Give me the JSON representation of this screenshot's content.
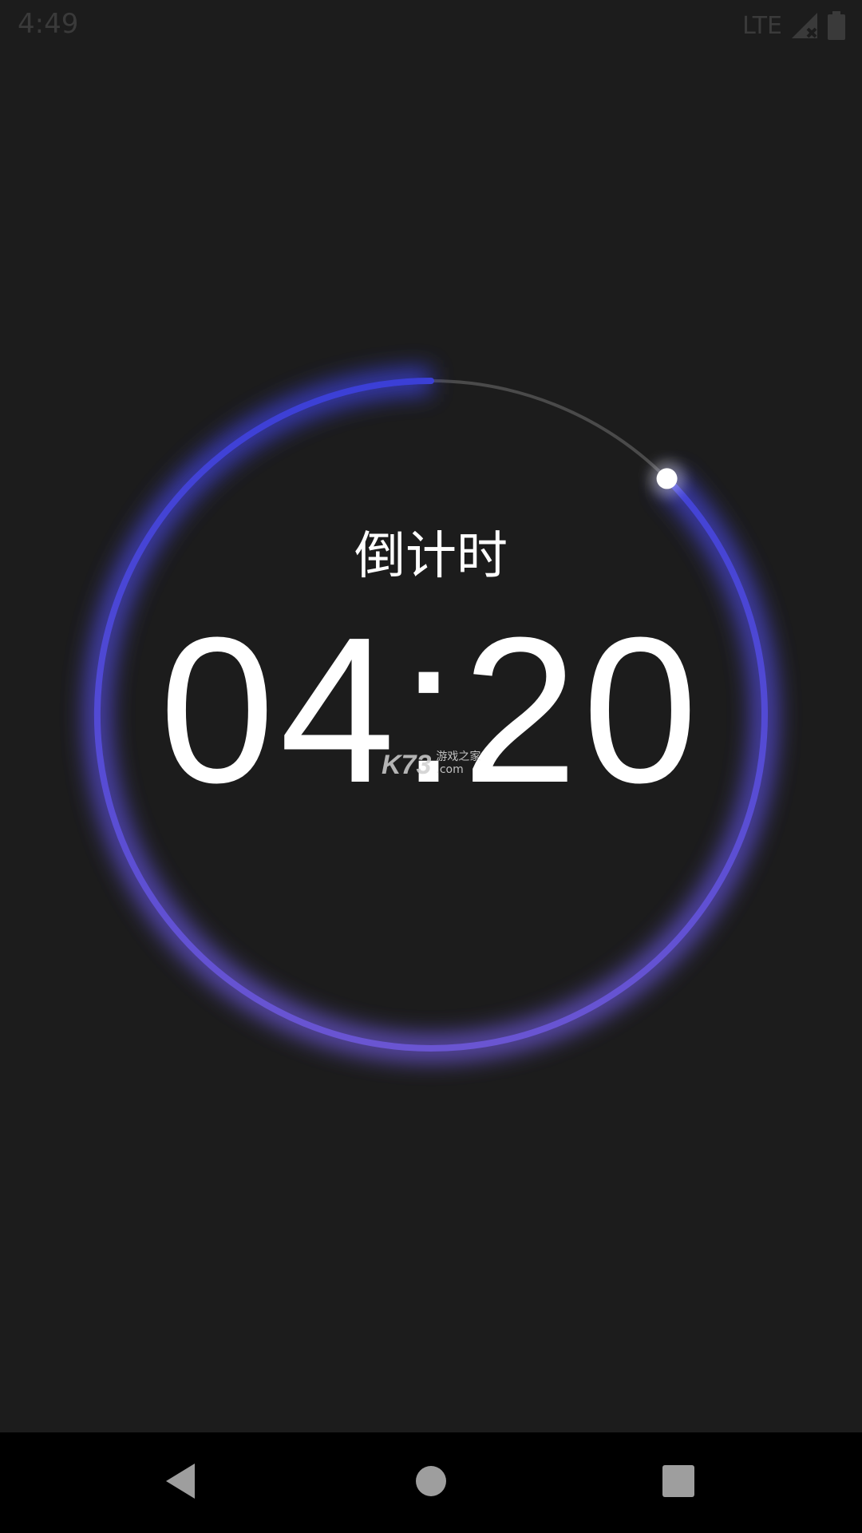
{
  "status_bar": {
    "time": "4:49",
    "network": "LTE"
  },
  "timer": {
    "label": "倒计时",
    "value": "04:20",
    "progress_fraction": 0.875
  },
  "watermark": {
    "brand": "K73",
    "line1": "游戏之家",
    "line2": ".com"
  },
  "colors": {
    "background": "#1c1c1c",
    "ring_top": "#3b3fd6",
    "ring_bottom": "#6a55d2",
    "track": "#4a4a4a",
    "text": "#ffffff",
    "nav_bar": "#000000"
  },
  "nav_bar": {
    "back_icon": "back-triangle-icon",
    "home_icon": "home-circle-icon",
    "recent_icon": "recent-square-icon"
  }
}
